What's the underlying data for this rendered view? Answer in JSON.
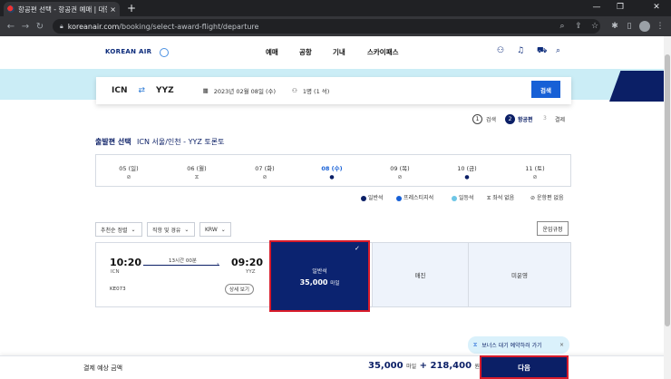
{
  "browser": {
    "tab_title": "항공편 선택 - 항공권 예매 | 대한항공",
    "url_host": "koreanair.com",
    "url_path": "/booking/select-award-flight/departure",
    "new_tab": "+",
    "tab_close": "×",
    "window_min": "—",
    "window_max": "❐",
    "window_close": "✕"
  },
  "site": {
    "logo": "KOREAN AIR",
    "nav": [
      "예매",
      "공항",
      "기내",
      "스카이패스"
    ]
  },
  "search": {
    "origin": "ICN",
    "destination": "YYZ",
    "date": "2023년 02월 08일 (수)",
    "pax": "1명 (1 석)",
    "button": "검색"
  },
  "steps": [
    {
      "num": "1",
      "label": "검색"
    },
    {
      "num": "2",
      "label": "항공편"
    },
    {
      "num": "3",
      "label": "결제"
    }
  ],
  "title": "출발편 선택",
  "route": "ICN 서울/인천 - YYZ 토론토",
  "dates": [
    {
      "label": "05 (일)",
      "icon": "⊘"
    },
    {
      "label": "06 (월)",
      "icon": "⧖"
    },
    {
      "label": "07 (화)",
      "icon": "⊘"
    },
    {
      "label": "08 (수)",
      "icon": "●"
    },
    {
      "label": "09 (목)",
      "icon": "⊘"
    },
    {
      "label": "10 (금)",
      "icon": "●"
    },
    {
      "label": "11 (토)",
      "icon": "⊘"
    }
  ],
  "legend": [
    {
      "label": "일반석",
      "color": "#0b1f66"
    },
    {
      "label": "프레스티지석",
      "color": "#1760d6"
    },
    {
      "label": "일등석",
      "color": "#6ec6e6"
    },
    {
      "label": "좌석 없음",
      "color": "#ffffff"
    },
    {
      "label": "운항편 없음",
      "color": "#ffffff"
    }
  ],
  "filters": {
    "sort": "추천순 정렬",
    "stops": "직항 및 경유",
    "currency": "KRW",
    "fare_rules": "운임규정"
  },
  "flight": {
    "dep_time": "10:20",
    "dep_airport": "ICN",
    "arr_time": "09:20",
    "arr_airport": "YYZ",
    "duration": "13시간 00분",
    "flight_no": "KE073",
    "detail": "상세 보기"
  },
  "fares": {
    "economy_label": "일반석",
    "economy_miles": "35,000",
    "miles_unit": "마일",
    "prestige": "매진",
    "first": "미운영"
  },
  "waitlist": {
    "label": "보너스 대기 예약하러 가기"
  },
  "footer": {
    "label": "결제 예상 금액",
    "miles": "35,000",
    "miles_unit": "마일",
    "plus": "+",
    "won": "218,400",
    "won_unit": "원",
    "next": "다음"
  },
  "colors": {
    "brand": "#0b1f66",
    "accent": "#1760d6",
    "highlight": "#d81b2a",
    "banner": "#cbedf6"
  }
}
